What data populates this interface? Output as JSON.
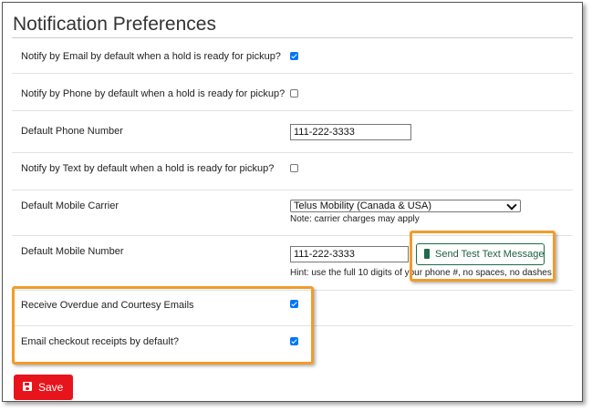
{
  "title": "Notification Preferences",
  "rows": {
    "email_hold": {
      "label": "Notify by Email by default when a hold is ready for pickup?",
      "checked": true
    },
    "phone_hold": {
      "label": "Notify by Phone by default when a hold is ready for pickup?",
      "checked": false
    },
    "default_phone": {
      "label": "Default Phone Number",
      "value": "111-222-3333"
    },
    "text_hold": {
      "label": "Notify by Text by default when a hold is ready for pickup?",
      "checked": false
    },
    "mobile_carrier": {
      "label": "Default Mobile Carrier",
      "selected": "Telus Mobility (Canada & USA)",
      "note": "Note: carrier charges may apply"
    },
    "mobile_number": {
      "label": "Default Mobile Number",
      "value": "111-222-3333",
      "hint": "Hint: use the full 10 digits of your phone #, no spaces, no dashes",
      "test_button": "Send Test Text Message"
    },
    "overdue_emails": {
      "label": "Receive Overdue and Courtesy Emails",
      "checked": true
    },
    "checkout_receipts": {
      "label": "Email checkout receipts by default?",
      "checked": true
    }
  },
  "save_button": "Save",
  "icons": {
    "test_button": "mobile-phone-icon",
    "save_button": "floppy-disk-icon"
  },
  "colors": {
    "checkbox": "#0075ff",
    "highlight": "#f39b2b",
    "save": "#e8141c",
    "test_button": "#1f6b4a"
  }
}
